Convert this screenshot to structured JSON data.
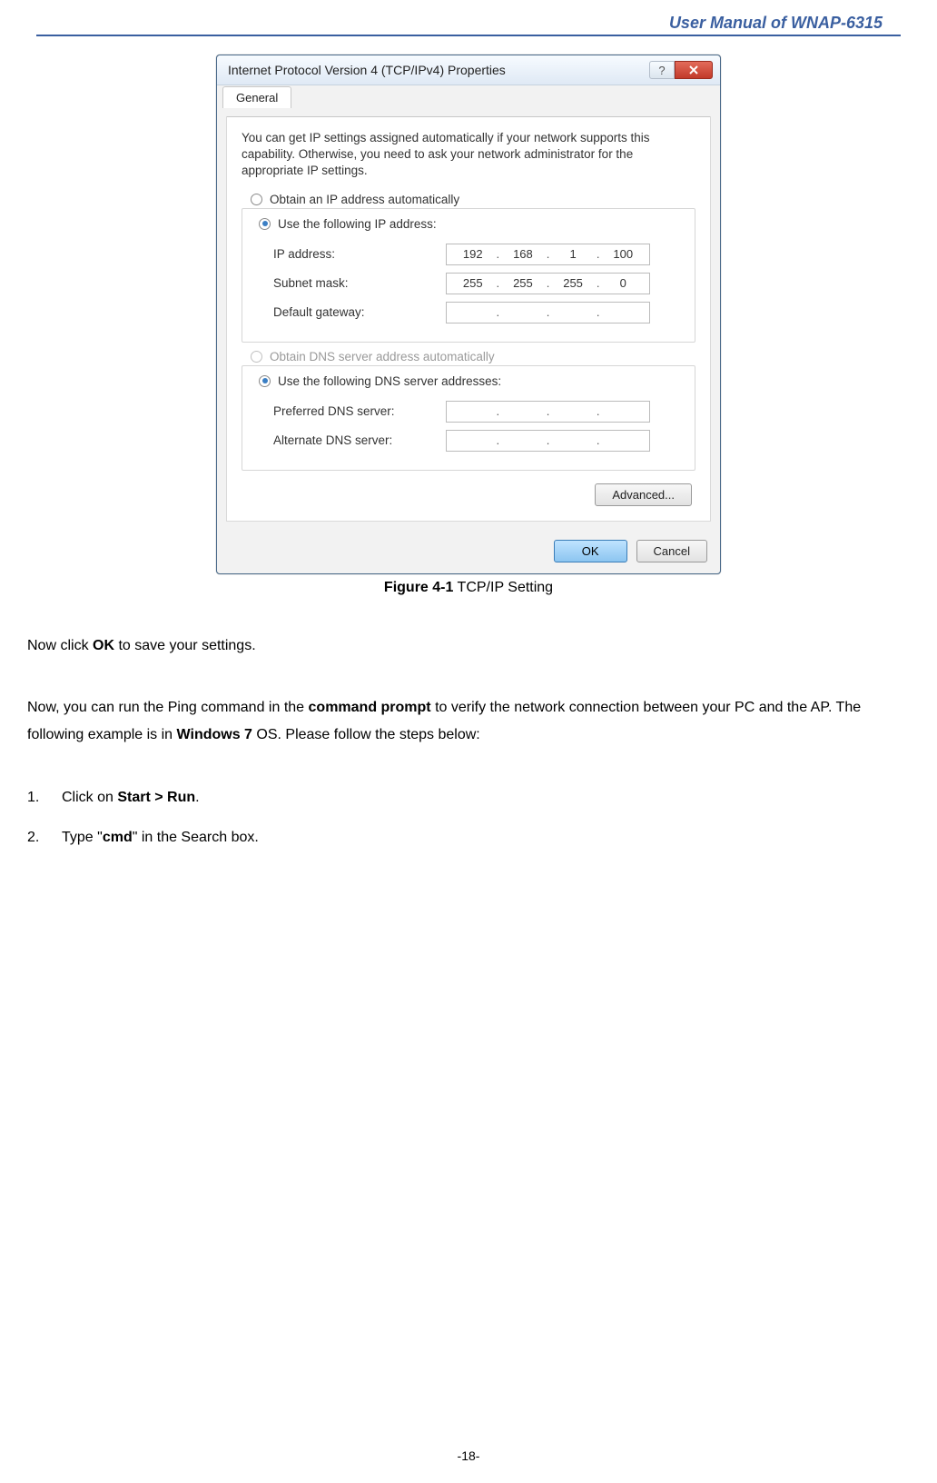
{
  "header": {
    "title": "User Manual of WNAP-6315"
  },
  "dialog": {
    "title": "Internet Protocol Version 4 (TCP/IPv4) Properties",
    "help_glyph": "?",
    "tab": "General",
    "description": "You can get IP settings assigned automatically if your network supports this capability. Otherwise, you need to ask your network administrator for the appropriate IP settings.",
    "ip": {
      "auto_label": "Obtain an IP address automatically",
      "manual_label": "Use the following IP address:",
      "address_label": "IP address:",
      "address_o1": "192",
      "address_o2": "168",
      "address_o3": "1",
      "address_o4": "100",
      "mask_label": "Subnet mask:",
      "mask_o1": "255",
      "mask_o2": "255",
      "mask_o3": "255",
      "mask_o4": "0",
      "gateway_label": "Default gateway:"
    },
    "dns": {
      "auto_label": "Obtain DNS server address automatically",
      "manual_label": "Use the following DNS server addresses:",
      "preferred_label": "Preferred DNS server:",
      "alternate_label": "Alternate DNS server:"
    },
    "advanced_btn": "Advanced...",
    "ok_btn": "OK",
    "cancel_btn": "Cancel"
  },
  "caption": {
    "bold": "Figure 4-1",
    "rest": " TCP/IP Setting"
  },
  "body": {
    "p1_pre": "Now click ",
    "p1_bold": "OK",
    "p1_post": " to save your settings.",
    "p2_a": "Now, you can run the Ping command in the ",
    "p2_b": "command prompt",
    "p2_c": " to verify the network connection between your PC and the AP. The following example is in ",
    "p2_d": "Windows 7",
    "p2_e": " OS. Please follow the steps below:",
    "li1_num": "1.",
    "li1_a": "Click on ",
    "li1_b": "Start > Run",
    "li1_c": ".",
    "li2_num": "2.",
    "li2_a": "Type \"",
    "li2_b": "cmd",
    "li2_c": "\" in the Search box."
  },
  "footer": {
    "page": "-18-"
  }
}
